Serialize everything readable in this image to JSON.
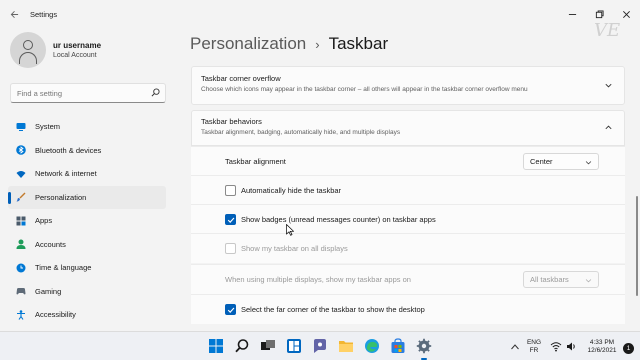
{
  "window": {
    "app_title": "Settings",
    "controls": {
      "minimize": "—",
      "maximize": "☐",
      "close": "✕"
    }
  },
  "profile": {
    "name": "ur username",
    "account_type": "Local Account"
  },
  "search": {
    "placeholder": "Find a setting"
  },
  "nav": {
    "items": [
      {
        "label": "System",
        "icon": "monitor-icon",
        "color": "#0078d4"
      },
      {
        "label": "Bluetooth & devices",
        "icon": "bluetooth-icon",
        "color": "#0078d4"
      },
      {
        "label": "Network & internet",
        "icon": "wifi-icon",
        "color": "#0067c0"
      },
      {
        "label": "Personalization",
        "icon": "brush-icon",
        "color": "#c27a2c"
      },
      {
        "label": "Apps",
        "icon": "apps-grid-icon",
        "color": "#4a5a6a"
      },
      {
        "label": "Accounts",
        "icon": "person-icon",
        "color": "#1e9c5a"
      },
      {
        "label": "Time & language",
        "icon": "globe-clock-icon",
        "color": "#0078d4"
      },
      {
        "label": "Gaming",
        "icon": "gamepad-icon",
        "color": "#5f6b78"
      },
      {
        "label": "Accessibility",
        "icon": "accessibility-icon",
        "color": "#0078d4"
      }
    ],
    "active_index": 3
  },
  "breadcrumb": {
    "parent": "Personalization",
    "separator": "›",
    "current": "Taskbar"
  },
  "overflow_card": {
    "title": "Taskbar corner overflow",
    "subtitle": "Choose which icons may appear in the taskbar corner – all others will appear in the taskbar corner overflow menu"
  },
  "behaviors_card": {
    "title": "Taskbar behaviors",
    "subtitle": "Taskbar alignment, badging, automatically hide, and multiple displays"
  },
  "behaviors": {
    "alignment_label": "Taskbar alignment",
    "alignment_value": "Center",
    "auto_hide_label": "Automatically hide the taskbar",
    "auto_hide_checked": false,
    "badges_label": "Show badges (unread messages counter) on taskbar apps",
    "badges_checked": true,
    "all_displays_label": "Show my taskbar on all displays",
    "all_displays_checked": false,
    "multi_display_label": "When using multiple displays, show my taskbar apps on",
    "multi_display_value": "All taskbars",
    "far_corner_label": "Select the far corner of the taskbar to show the desktop",
    "far_corner_checked": true
  },
  "taskbar": {
    "apps": [
      "start-icon",
      "search-icon",
      "task-view-icon",
      "widgets-icon",
      "chat-icon",
      "file-explorer-icon",
      "edge-icon",
      "store-icon",
      "settings-icon"
    ],
    "language": {
      "line1": "ENG",
      "line2": "FR"
    },
    "time": "4:33 PM",
    "date": "12/6/2021",
    "notification_count": "1"
  },
  "accent_color": "#005fb8"
}
